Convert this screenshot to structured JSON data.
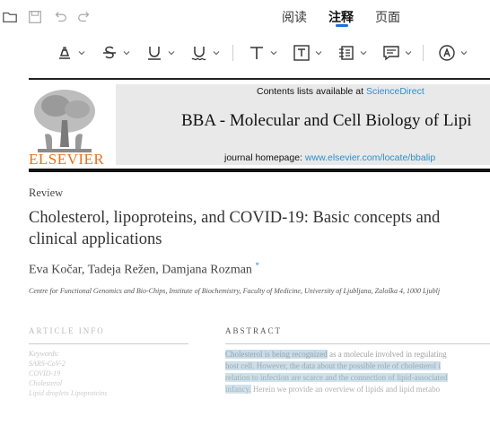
{
  "tabs": [
    {
      "label": "阅读"
    },
    {
      "label": "注释"
    },
    {
      "label": "页面"
    }
  ],
  "active_tab": "注释",
  "accent_color": "#1e6fd9",
  "toolbar_icons": [
    "folder-open-icon",
    "save-icon",
    "undo-icon",
    "redo-icon"
  ],
  "annotation_tools": [
    "highlight-tool",
    "strikethrough-tool",
    "underline-tool",
    "squiggly-underline-tool",
    "text-tool",
    "textbox-tool",
    "note-tool",
    "comment-tool",
    "stamp-tool"
  ],
  "document": {
    "contents_prefix": "Contents lists available at ",
    "contents_link": "ScienceDirect",
    "journal": "BBA - Molecular and Cell Biology of Lipi",
    "homepage_prefix": "journal homepage: ",
    "homepage_link": "www.elsevier.com/locate/bbalip",
    "publisher": "ELSEVIER",
    "article_type": "Review",
    "title_line1": "Cholesterol, lipoproteins, and COVID-19: Basic concepts and",
    "title_line2": "clinical applications",
    "authors": "Eva Kočar, Tadeja Režen, Damjana Rozman",
    "author_mark": "*",
    "affiliation": "Centre for Functional Genomics and Bio-Chips, Institute of Biochemistry, Faculty of Medicine, University of Ljubljana, Zaloška 4, 1000 Ljublj",
    "article_info_heading": "ARTICLE INFO",
    "abstract_heading": "ABSTRACT",
    "keywords": [
      "Keywords:",
      "SARS-CoV-2",
      "COVID-19",
      "Cholesterol",
      "Lipid droplets Lipoproteins"
    ],
    "abstract_lines": [
      {
        "hl": "Cholesterol is being recognized",
        "rest": " as a molecule involved in regulating"
      },
      {
        "hl": "host cell. However, the data about the possible role of cholesterol i",
        "rest": ""
      },
      {
        "hl": "relation to infection are scarce and the connection of lipid-associated",
        "rest": ""
      },
      {
        "hl": "infancy.",
        "rest": " Herein we provide an overview of lipids and lipid metabo"
      }
    ]
  }
}
